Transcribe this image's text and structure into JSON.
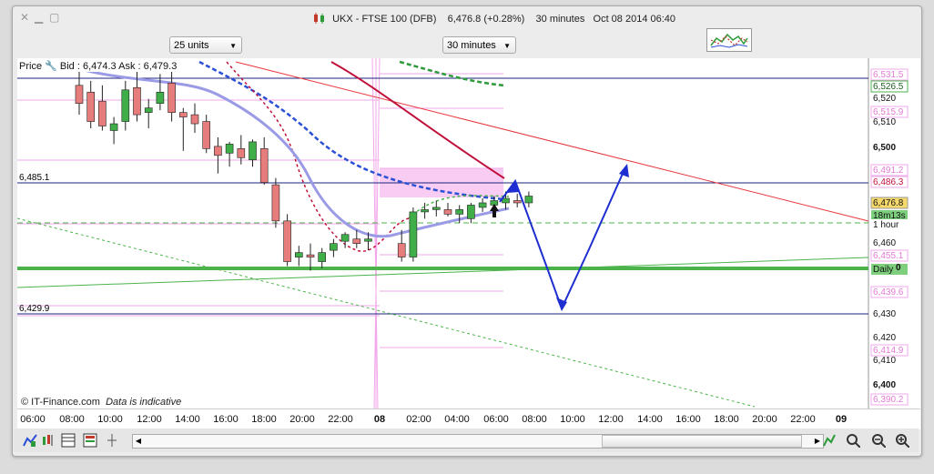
{
  "window": {
    "title": "UKX - FTSE 100 (DFB)",
    "price_info": "6,476.8 (+0.28%)",
    "timeframe": "30 minutes",
    "datetime": "Oct 08 2014 06:40"
  },
  "controls": {
    "units_select": "25 units",
    "interval_select": "30 minutes"
  },
  "chart_header": {
    "label": "Price",
    "bid_ask": "Bid : 6,474.3  Ask : 6,479.3",
    "copyright": "© IT-Finance.com",
    "disclaimer": "Data is indicative"
  },
  "left_labels": {
    "level_upper": "6,485.1",
    "level_lower": "6,429.9"
  },
  "right_axis": {
    "ticks": [
      "6,520",
      "6,510",
      "6,500",
      "6,460",
      "6,430",
      "6,420",
      "6,410",
      "6,400"
    ],
    "pink_labels": [
      "6,531.5",
      "6,515.9",
      "6,491.2",
      "6,486.3",
      "6,455.1",
      "6,439.6",
      "6,414.9",
      "6,390.2"
    ],
    "green_label": "6,526.5",
    "current_price": "6,476.8",
    "countdown": "18m13s",
    "period": "1 hour",
    "daily_label": "Daily",
    "daily_value_fragment": "0"
  },
  "x_axis": {
    "labels": [
      "06:00",
      "08:00",
      "10:00",
      "12:00",
      "14:00",
      "16:00",
      "18:00",
      "20:00",
      "22:00",
      "08",
      "02:00",
      "04:00",
      "06:00",
      "08:00",
      "10:00",
      "12:00",
      "14:00",
      "16:00",
      "18:00",
      "20:00",
      "22:00",
      "09"
    ]
  },
  "chart_data": {
    "type": "candlestick",
    "title": "UKX - FTSE 100 (DFB)",
    "ylim": [
      6385,
      6540
    ],
    "candles": [
      {
        "o": 6528,
        "h": 6534,
        "l": 6515,
        "c": 6520,
        "dir": "down"
      },
      {
        "o": 6525,
        "h": 6530,
        "l": 6509,
        "c": 6512,
        "dir": "down"
      },
      {
        "o": 6521,
        "h": 6528,
        "l": 6508,
        "c": 6510,
        "dir": "down"
      },
      {
        "o": 6508,
        "h": 6514,
        "l": 6502,
        "c": 6511,
        "dir": "up"
      },
      {
        "o": 6512,
        "h": 6530,
        "l": 6508,
        "c": 6526,
        "dir": "up"
      },
      {
        "o": 6527,
        "h": 6535,
        "l": 6512,
        "c": 6515,
        "dir": "down"
      },
      {
        "o": 6516,
        "h": 6522,
        "l": 6509,
        "c": 6518,
        "dir": "up"
      },
      {
        "o": 6520,
        "h": 6533,
        "l": 6517,
        "c": 6525,
        "dir": "up"
      },
      {
        "o": 6529,
        "h": 6536,
        "l": 6512,
        "c": 6516,
        "dir": "down"
      },
      {
        "o": 6516,
        "h": 6518,
        "l": 6499,
        "c": 6514,
        "dir": "down"
      },
      {
        "o": 6515,
        "h": 6520,
        "l": 6507,
        "c": 6511,
        "dir": "down"
      },
      {
        "o": 6512,
        "h": 6515,
        "l": 6498,
        "c": 6500,
        "dir": "down"
      },
      {
        "o": 6501,
        "h": 6505,
        "l": 6489,
        "c": 6497,
        "dir": "down"
      },
      {
        "o": 6498,
        "h": 6503,
        "l": 6492,
        "c": 6502,
        "dir": "up"
      },
      {
        "o": 6500,
        "h": 6506,
        "l": 6493,
        "c": 6496,
        "dir": "down"
      },
      {
        "o": 6495,
        "h": 6504,
        "l": 6492,
        "c": 6503,
        "dir": "up"
      },
      {
        "o": 6500,
        "h": 6505,
        "l": 6484,
        "c": 6485,
        "dir": "down"
      },
      {
        "o": 6484,
        "h": 6487,
        "l": 6465,
        "c": 6468,
        "dir": "down"
      },
      {
        "o": 6468,
        "h": 6471,
        "l": 6448,
        "c": 6450,
        "dir": "down"
      },
      {
        "o": 6452,
        "h": 6457,
        "l": 6448,
        "c": 6454,
        "dir": "up"
      },
      {
        "o": 6453,
        "h": 6458,
        "l": 6446,
        "c": 6452,
        "dir": "down"
      },
      {
        "o": 6450,
        "h": 6456,
        "l": 6447,
        "c": 6454,
        "dir": "up"
      },
      {
        "o": 6455,
        "h": 6460,
        "l": 6452,
        "c": 6458,
        "dir": "up"
      },
      {
        "o": 6459,
        "h": 6463,
        "l": 6456,
        "c": 6462,
        "dir": "up"
      },
      {
        "o": 6460,
        "h": 6464,
        "l": 6456,
        "c": 6458,
        "dir": "down"
      },
      {
        "o": 6459,
        "h": 6463,
        "l": 6455,
        "c": 6460,
        "dir": "up"
      },
      {
        "o": 6458,
        "h": 6464,
        "l": 6450,
        "c": 6452,
        "dir": "down"
      },
      {
        "o": 6452,
        "h": 6474,
        "l": 6450,
        "c": 6472,
        "dir": "up"
      },
      {
        "o": 6472,
        "h": 6476,
        "l": 6469,
        "c": 6473,
        "dir": "up"
      },
      {
        "o": 6473,
        "h": 6477,
        "l": 6470,
        "c": 6474,
        "dir": "up"
      },
      {
        "o": 6473,
        "h": 6476,
        "l": 6470,
        "c": 6471,
        "dir": "down"
      },
      {
        "o": 6471,
        "h": 6475,
        "l": 6467,
        "c": 6473,
        "dir": "up"
      },
      {
        "o": 6469,
        "h": 6476,
        "l": 6467,
        "c": 6475,
        "dir": "up"
      },
      {
        "o": 6474,
        "h": 6478,
        "l": 6472,
        "c": 6476,
        "dir": "up"
      },
      {
        "o": 6475,
        "h": 6479,
        "l": 6472,
        "c": 6477,
        "dir": "up"
      },
      {
        "o": 6476,
        "h": 6481,
        "l": 6473,
        "c": 6478,
        "dir": "up"
      },
      {
        "o": 6477,
        "h": 6480,
        "l": 6474,
        "c": 6476,
        "dir": "down"
      },
      {
        "o": 6476,
        "h": 6481,
        "l": 6474,
        "c": 6479,
        "dir": "up"
      }
    ],
    "levels": {
      "upper": 6485.1,
      "lower": 6429.9,
      "green_top": 6526.5,
      "daily": 6450,
      "hour": 6468
    }
  },
  "colors": {
    "up_candle": "#3fae49",
    "down_candle": "#e67c7c",
    "projection": "#1f2ed1",
    "trend_red": "#e8373c",
    "ma_red": "#c0103a",
    "ma_blue": "#2b50d6",
    "ma_lavender": "#9a9ae6",
    "support_green": "#4cb34c",
    "pink_zone": "#f7c6f2"
  }
}
